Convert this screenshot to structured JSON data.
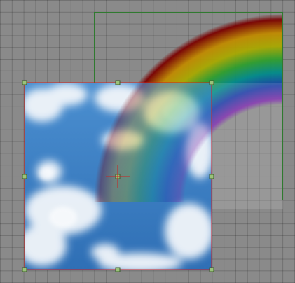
{
  "canvas": {
    "background_color": "#8a8a8a",
    "grid_line_color": "#7a7a7a"
  },
  "layers": [
    {
      "name": "sky-clouds",
      "selected": true,
      "selection_color": "#cc2222",
      "handle_color": "#3b7a2a"
    },
    {
      "name": "rainbow",
      "selected": false,
      "selection_color": "#2f7a2f"
    }
  ],
  "rainbow_colors": [
    "#7a0000",
    "#c08a00",
    "#a8a800",
    "#2e9e2e",
    "#008a8a",
    "#1a3aa8",
    "#7a2aa8"
  ]
}
